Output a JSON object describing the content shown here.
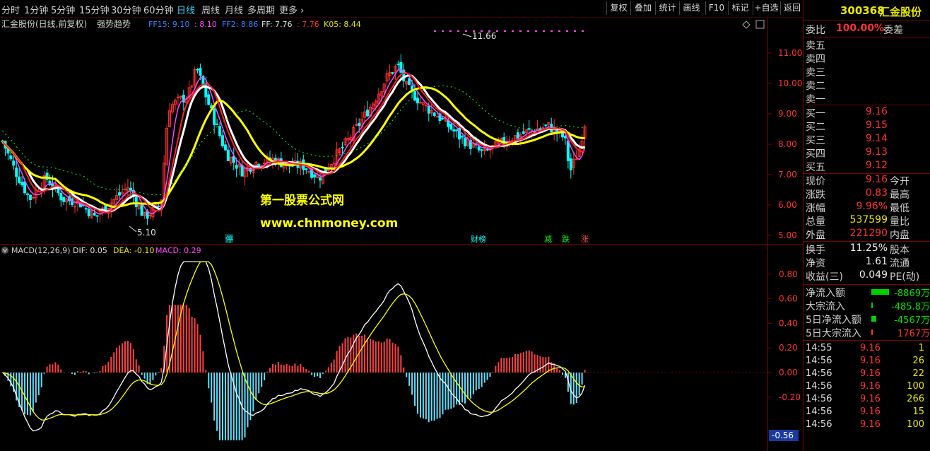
{
  "toolbar": {
    "timeframes": [
      "分时",
      "1分钟",
      "5分钟",
      "15分钟",
      "30分钟",
      "60分钟",
      "日线",
      "周线",
      "月线",
      "多周期",
      "更多"
    ],
    "active_timeframe": "日线",
    "buttons": [
      "复权",
      "叠加",
      "统计",
      "画线",
      "F10",
      "标记",
      "+自选",
      "返回"
    ]
  },
  "chart_header": {
    "stock_label": "汇金股份(日线,前复权)",
    "indicator_name": "强势趋势",
    "ff15": "FF15: 9.10",
    "ff15b": ": 8.10",
    "ff2": "FF2: 8.86",
    "ff": "FF: 7.76",
    "ff_b": ": 7.76",
    "k05": "K05: 8.44"
  },
  "price_axis": [
    "11.00",
    "10.00",
    "9.00",
    "8.00",
    "7.00",
    "6.00",
    "5.00"
  ],
  "annotations": {
    "high": "11.66",
    "low": "5.10",
    "tag1": "停",
    "tag2": "财榜",
    "tag3": "减",
    "tag4": "跌",
    "tag5": "涨"
  },
  "watermark": {
    "line1": "第一股票公式网",
    "line2": "www.chnmoney.com"
  },
  "macd_header": {
    "name": "MACD(12,26,9)",
    "dif": "DIF: 0.05",
    "dea": "DEA: -0.10",
    "macd": "MACD: 0.29"
  },
  "macd_axis": [
    "0.80",
    "0.60",
    "0.40",
    "0.20",
    "0.00",
    "-0.20"
  ],
  "macd_cursor_value": "-0.56",
  "stock": {
    "code": "300368",
    "name": "汇金股份"
  },
  "order_book": {
    "committee_label": "委比",
    "committee_value": "100.00%",
    "committee_diff_label": "委差",
    "sells": [
      {
        "label": "卖五",
        "price": ""
      },
      {
        "label": "卖四",
        "price": ""
      },
      {
        "label": "卖三",
        "price": ""
      },
      {
        "label": "卖二",
        "price": ""
      },
      {
        "label": "卖一",
        "price": ""
      }
    ],
    "buys": [
      {
        "label": "买一",
        "price": "9.16"
      },
      {
        "label": "买二",
        "price": "9.15"
      },
      {
        "label": "买三",
        "price": "9.14"
      },
      {
        "label": "买四",
        "price": "9.13"
      },
      {
        "label": "买五",
        "price": "9.12"
      }
    ]
  },
  "quote": [
    {
      "label": "现价",
      "value": "9.16",
      "label2": "今开",
      "cls": "red"
    },
    {
      "label": "涨跌",
      "value": "0.83",
      "label2": "最高",
      "cls": "red"
    },
    {
      "label": "涨幅",
      "value": "9.96%",
      "label2": "最低",
      "cls": "red"
    },
    {
      "label": "总量",
      "value": "537599",
      "label2": "量比",
      "cls": "yellow"
    },
    {
      "label": "外盘",
      "value": "221290",
      "label2": "内盘",
      "cls": "red"
    }
  ],
  "stats": [
    {
      "label": "换手",
      "value": "11.25%",
      "label2": "股本"
    },
    {
      "label": "净资",
      "value": "1.61",
      "label2": "流通"
    },
    {
      "label": "收益(三)",
      "value": "0.049",
      "label2": "PE(动)"
    }
  ],
  "flows": [
    {
      "label": "净流入额",
      "value": "-8869万",
      "bar": 52,
      "cls": "green",
      "barColor": "#00d000"
    },
    {
      "label": "大宗流入",
      "value": "-485.8万",
      "bar": 2,
      "cls": "green",
      "barColor": "#00d000"
    },
    {
      "label": "5日净流入额",
      "value": "-4567万",
      "bar": 14,
      "cls": "green",
      "barColor": "#00d000"
    },
    {
      "label": "5日大宗流入",
      "value": "1767万",
      "bar": 4,
      "cls": "red",
      "barColor": "#ff3030"
    }
  ],
  "ticks": [
    {
      "time": "14:55",
      "price": "9.16",
      "vol": "1"
    },
    {
      "time": "14:56",
      "price": "9.16",
      "vol": "26"
    },
    {
      "time": "14:56",
      "price": "9.16",
      "vol": "22"
    },
    {
      "time": "14:56",
      "price": "9.16",
      "vol": "100"
    },
    {
      "time": "14:56",
      "price": "9.16",
      "vol": "266"
    },
    {
      "time": "14:56",
      "price": "9.16",
      "vol": "15"
    },
    {
      "time": "14:56",
      "price": "9.16",
      "vol": "100"
    }
  ],
  "colors": {
    "up": "#ff3030",
    "down": "#00ffff",
    "bg": "#000000",
    "grid": "#7a0000"
  }
}
